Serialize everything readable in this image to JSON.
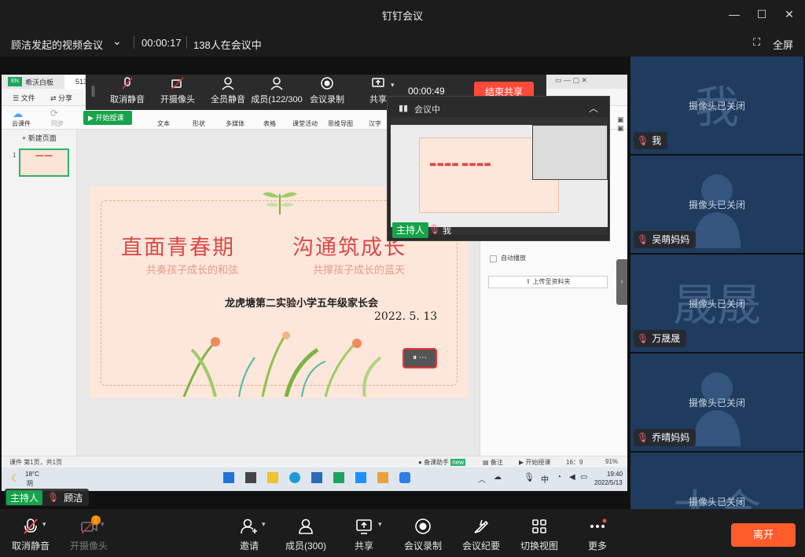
{
  "window": {
    "title": "钉钉会议"
  },
  "infobar": {
    "meeting_name": "顾洁发起的视频会议",
    "duration": "00:00:17",
    "participants_text": "138人在会议中",
    "fullscreen_label": "全屏"
  },
  "share_toolbar": {
    "items": [
      "取消静音",
      "开摄像头",
      "全员静音",
      "成员(122/300",
      "会议录制",
      "共享"
    ],
    "timer": "00:00:49",
    "end_share_label": "结束共享"
  },
  "float_window": {
    "label": "会议中",
    "host_badge": "主持人",
    "self_name": "我"
  },
  "app": {
    "tabs": [
      "希沃白板",
      "513"
    ],
    "menu": [
      "文件",
      "分享"
    ],
    "tools": [
      "文本",
      "形状",
      "多媒体",
      "表格",
      "课堂活动",
      "思维导图",
      "汉字"
    ],
    "left_tools": [
      "云课件",
      "同步"
    ],
    "start_button": "开始授课",
    "new_page": "新建页面",
    "page_number": "1",
    "right_panel": {
      "autoplay": "自动播放",
      "upload": "上传至资料夹"
    },
    "statusbar": {
      "page_info": "课件 第1页，共1页",
      "assistant": "备课助手",
      "new_badge": "new",
      "notes": "备注",
      "start_teaching": "开始授课",
      "ratio": "16：9",
      "zoom": "91%"
    }
  },
  "slide": {
    "title_left": "直面青春期",
    "title_right": "沟通筑成长",
    "subtitle_left": "共奏孩子成长的和弦",
    "subtitle_right": "共撑孩子成长的蓝天",
    "school": "龙虎塘第二实验小学五年级家长会",
    "date": "2022. 5. 13"
  },
  "taskbar": {
    "weather_temp": "18°C",
    "weather_desc": "阴",
    "ime": "中",
    "time": "19:40",
    "date": "2022/5/13"
  },
  "presenter": {
    "host_badge": "主持人",
    "name": "顾洁"
  },
  "tiles": [
    {
      "name": "我",
      "big": "我",
      "status": "摄像头已关闭"
    },
    {
      "name": "吴萌妈妈",
      "big": "",
      "status": "摄像头已关闭"
    },
    {
      "name": "万晟晟",
      "big": "晟晟",
      "status": "摄像头已关闭"
    },
    {
      "name": "乔晴妈妈",
      "big": "",
      "status": "摄像头已关闭"
    },
    {
      "name": "",
      "big": "太含",
      "status": "摄像头已关闭"
    }
  ],
  "bottombar": {
    "unmute": "取消静音",
    "camera": "开摄像头",
    "camera_badge": "!",
    "invite": "邀请",
    "members": "成员(300)",
    "share": "共享",
    "record": "会议录制",
    "minutes": "会议纪要",
    "switch_view": "切换视图",
    "more": "更多",
    "leave": "离开"
  },
  "colors": {
    "accent_orange": "#ff5b2b",
    "host_green": "#16a34a",
    "tile_blue": "#1f3b5e",
    "slide_red": "#d84a4a"
  }
}
